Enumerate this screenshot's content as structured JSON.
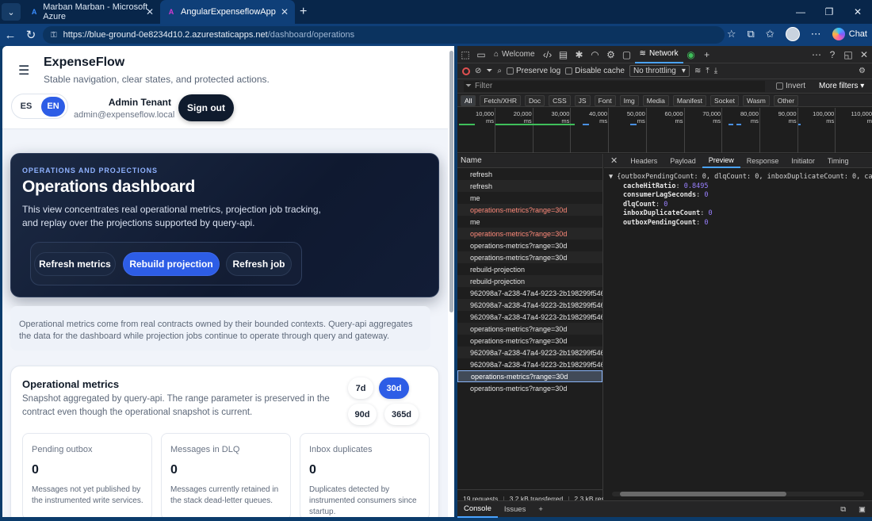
{
  "browser": {
    "tabs": [
      {
        "title": "Marban Marban - Microsoft Azure"
      },
      {
        "title": "AngularExpenseflowApp"
      }
    ],
    "url_host": "https://blue-ground-0e8234d10.2.azurestaticapps.net",
    "url_path": "/dashboard/operations",
    "chat_label": "Chat"
  },
  "header": {
    "app_name": "ExpenseFlow",
    "tagline": "Stable navigation, clear states, and protected actions.",
    "lang_es": "ES",
    "lang_en": "EN",
    "user_name": "Admin Tenant",
    "user_email": "admin@expenseflow.local",
    "signout": "Sign out"
  },
  "hero": {
    "kicker": "OPERATIONS AND PROJECTIONS",
    "title": "Operations dashboard",
    "description": "This view concentrates real operational metrics, projection job tracking, and replay over the projections supported by query-api.",
    "actions": [
      "Refresh metrics",
      "Rebuild projection",
      "Refresh job"
    ]
  },
  "note": "Operational metrics come from real contracts owned by their bounded contexts. Query-api aggregates the data for the dashboard while projection jobs continue to operate through query and gateway.",
  "operational": {
    "title": "Operational metrics",
    "subtitle": "Snapshot aggregated by query-api. The range parameter is preserved in the contract even though the operational snapshot is current.",
    "ranges": [
      "7d",
      "30d",
      "90d",
      "365d"
    ],
    "selected_range": "30d",
    "metrics": [
      {
        "label": "Pending outbox",
        "value": "0",
        "desc": "Messages not yet published by the instrumented write services."
      },
      {
        "label": "Messages in DLQ",
        "value": "0",
        "desc": "Messages currently retained in the stack dead-letter queues."
      },
      {
        "label": "Inbox duplicates",
        "value": "0",
        "desc": "Duplicates detected by instrumented consumers since startup."
      }
    ]
  },
  "devtools": {
    "tabs": {
      "welcome": "Welcome",
      "network": "Network"
    },
    "toolbar": {
      "preserve_log": "Preserve log",
      "disable_cache": "Disable cache",
      "throttling": "No throttling"
    },
    "filter": {
      "placeholder": "Filter",
      "invert": "Invert",
      "more_filters": "More filters"
    },
    "types": [
      "All",
      "Fetch/XHR",
      "Doc",
      "CSS",
      "JS",
      "Font",
      "Img",
      "Media",
      "Manifest",
      "Socket",
      "Wasm",
      "Other"
    ],
    "timeline_ticks": [
      "10,000 ms",
      "20,000 ms",
      "30,000 ms",
      "40,000 ms",
      "50,000 ms",
      "60,000 ms",
      "70,000 ms",
      "80,000 ms",
      "90,000 ms",
      "100,000 ms",
      "110,000 m"
    ],
    "name_header": "Name",
    "requests": [
      {
        "name": "refresh",
        "state": "normal"
      },
      {
        "name": "refresh",
        "state": "normal"
      },
      {
        "name": "me",
        "state": "normal"
      },
      {
        "name": "operations-metrics?range=30d",
        "state": "error"
      },
      {
        "name": "me",
        "state": "normal"
      },
      {
        "name": "operations-metrics?range=30d",
        "state": "error"
      },
      {
        "name": "operations-metrics?range=30d",
        "state": "normal"
      },
      {
        "name": "operations-metrics?range=30d",
        "state": "normal"
      },
      {
        "name": "rebuild-projection",
        "state": "normal"
      },
      {
        "name": "rebuild-projection",
        "state": "normal"
      },
      {
        "name": "962098a7-a238-47a4-9223-2b198299f546",
        "state": "normal"
      },
      {
        "name": "962098a7-a238-47a4-9223-2b198299f546",
        "state": "normal"
      },
      {
        "name": "962098a7-a238-47a4-9223-2b198299f546",
        "state": "normal"
      },
      {
        "name": "operations-metrics?range=30d",
        "state": "normal"
      },
      {
        "name": "operations-metrics?range=30d",
        "state": "normal"
      },
      {
        "name": "962098a7-a238-47a4-9223-2b198299f546",
        "state": "normal"
      },
      {
        "name": "962098a7-a238-47a4-9223-2b198299f546",
        "state": "normal"
      },
      {
        "name": "operations-metrics?range=30d",
        "state": "selected"
      },
      {
        "name": "operations-metrics?range=30d",
        "state": "normal"
      }
    ],
    "status": {
      "requests": "19 requests",
      "transferred": "3.2 kB transferred",
      "resources": "2.3 kB resou"
    },
    "detail_tabs": [
      "Headers",
      "Payload",
      "Preview",
      "Response",
      "Initiator",
      "Timing"
    ],
    "selected_detail_tab": "Preview",
    "preview_summary": "{outboxPendingCount: 0, dlqCount: 0, inboxDuplicateCount: 0, cacheHi",
    "preview_fields": [
      {
        "key": "cacheHitRatio",
        "value": "0.8495"
      },
      {
        "key": "consumerLagSeconds",
        "value": "0"
      },
      {
        "key": "dlqCount",
        "value": "0"
      },
      {
        "key": "inboxDuplicateCount",
        "value": "0"
      },
      {
        "key": "outboxPendingCount",
        "value": "0"
      }
    ],
    "drawer": {
      "console": "Console",
      "issues": "Issues"
    }
  }
}
